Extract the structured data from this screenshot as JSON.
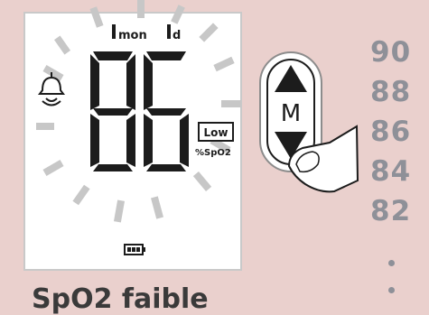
{
  "display": {
    "reading": "86",
    "alarm_icon": "alarm-bell-icon",
    "history_month_label": "mon",
    "history_day_label": "d",
    "status_badge": "Low",
    "unit": "%SpO2",
    "battery_icon": "battery-icon",
    "segment_color": "#1c1c1c",
    "lcd_background": "#ffffff",
    "bezel_color": "#c9c9c9"
  },
  "control": {
    "button_label": "M",
    "up_icon": "triangle-up-icon",
    "down_icon": "triangle-down-icon",
    "finger_icon": "finger-press-icon"
  },
  "scale": {
    "values": [
      "90",
      "88",
      "86",
      "84",
      "82"
    ],
    "color": "#8e9098"
  },
  "caption": "SpO2 faible"
}
